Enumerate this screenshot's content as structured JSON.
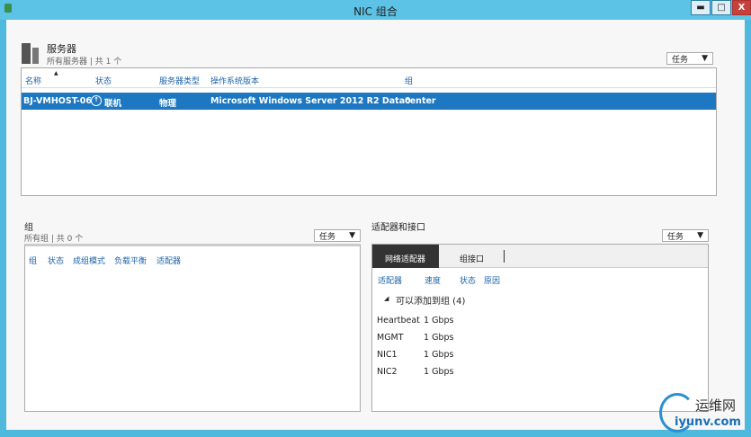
{
  "window": {
    "title": "NIC 组合",
    "min": "▬",
    "max": "□",
    "close": "X"
  },
  "servers": {
    "title": "服务器",
    "subtitle": "所有服务器 | 共 1 个",
    "tasks": "任务",
    "columns": [
      "名称",
      "状态",
      "服务器类型",
      "操作系统版本",
      "组"
    ],
    "rows": [
      {
        "name": "BJ-VMHOST-06",
        "status": "联机",
        "type": "物理",
        "os": "Microsoft Windows Server 2012 R2 Datacenter",
        "group": "0"
      }
    ]
  },
  "groups": {
    "title": "组",
    "subtitle": "所有组 | 共 0 个",
    "tasks": "任务",
    "columns": [
      "组",
      "状态",
      "成组模式",
      "负载平衡",
      "适配器"
    ]
  },
  "adapters": {
    "title": "适配器和接口",
    "tasks": "任务",
    "tabs": [
      "网络适配器",
      "组接口"
    ],
    "columns": [
      "适配器",
      "速度",
      "状态",
      "原因"
    ],
    "group_label": "可以添加到组 (4)",
    "rows": [
      {
        "name": "Heartbeat",
        "speed": "1 Gbps"
      },
      {
        "name": "MGMT",
        "speed": "1 Gbps"
      },
      {
        "name": "NIC1",
        "speed": "1 Gbps"
      },
      {
        "name": "NIC2",
        "speed": "1 Gbps"
      }
    ]
  },
  "watermark": {
    "cn": "运维网",
    "url": "iyunv.com"
  }
}
